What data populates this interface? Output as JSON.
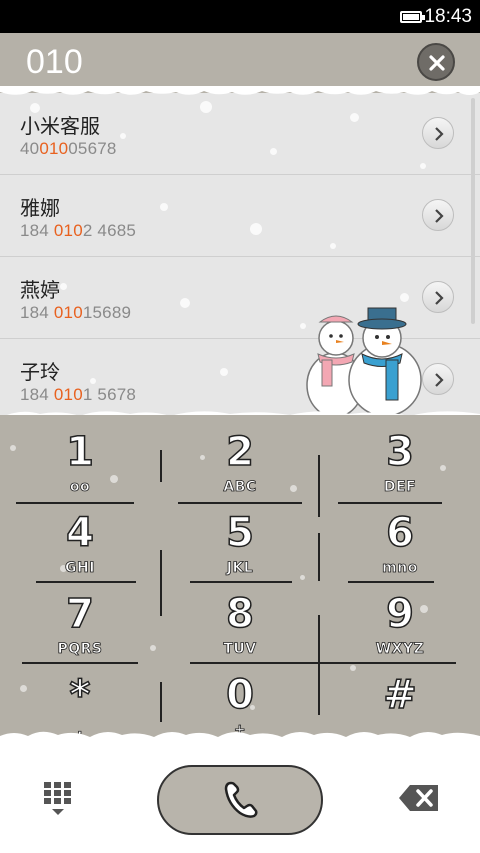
{
  "status_bar": {
    "time": "18:43",
    "battery_icon": "battery-full-icon"
  },
  "header": {
    "query": "010",
    "clear_icon": "close-icon"
  },
  "contacts": [
    {
      "name": "小米客服",
      "num_pre": "40",
      "num_hl": "010",
      "num_post": "05678"
    },
    {
      "name": "雅娜",
      "num_pre": "184 ",
      "num_hl": "010",
      "num_post": "2 4685"
    },
    {
      "name": "燕婷",
      "num_pre": "184 ",
      "num_hl": "010",
      "num_post": "15689"
    },
    {
      "name": "子玲",
      "num_pre": "184 ",
      "num_hl": "010",
      "num_post": "1 5678"
    }
  ],
  "keypad": [
    {
      "digit": "1",
      "letters": "oo"
    },
    {
      "digit": "2",
      "letters": "ABC"
    },
    {
      "digit": "3",
      "letters": "DEF"
    },
    {
      "digit": "4",
      "letters": "GHI"
    },
    {
      "digit": "5",
      "letters": "JKL"
    },
    {
      "digit": "6",
      "letters": "mno"
    },
    {
      "digit": "7",
      "letters": "PQRS"
    },
    {
      "digit": "8",
      "letters": "TUV"
    },
    {
      "digit": "9",
      "letters": "WXYZ"
    },
    {
      "digit": "*",
      "letters": ","
    },
    {
      "digit": "0",
      "letters": "+"
    },
    {
      "digit": "#",
      "letters": ""
    }
  ],
  "bottom_bar": {
    "dialpad_icon": "dialpad-icon",
    "call_icon": "phone-icon",
    "backspace_icon": "backspace-icon"
  },
  "colors": {
    "highlight": "#e8611f",
    "theme": "#b4b0a7"
  }
}
